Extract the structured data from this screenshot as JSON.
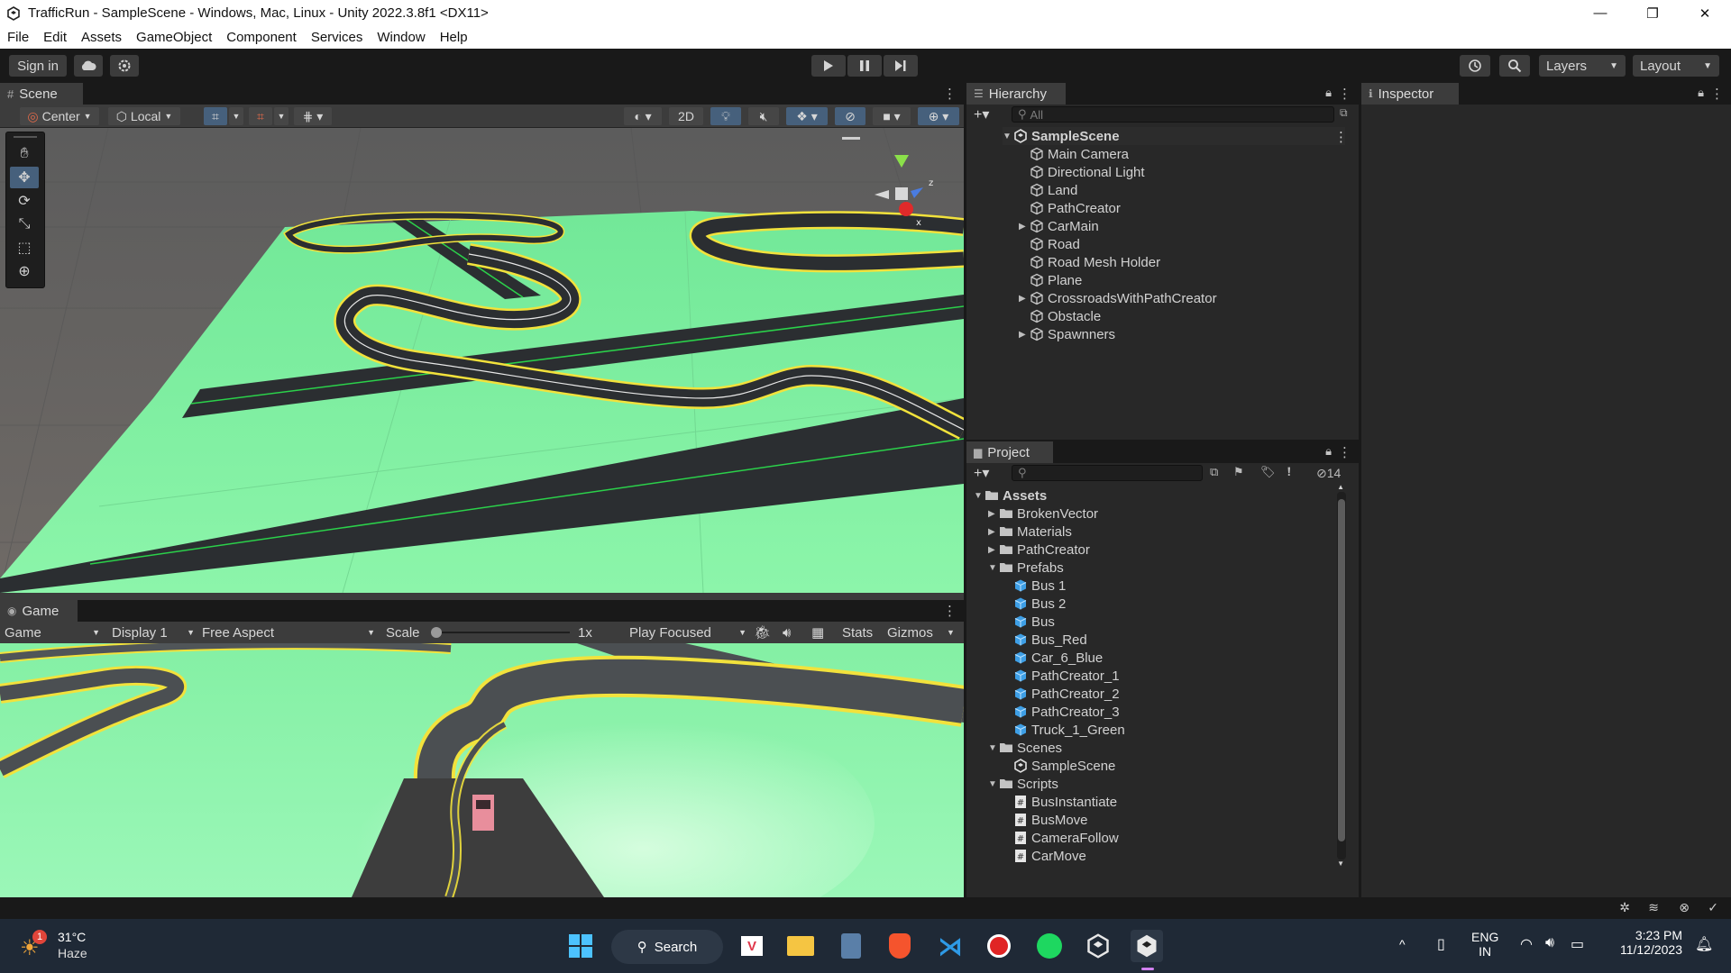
{
  "window": {
    "title": "TrafficRun - SampleScene - Windows, Mac, Linux - Unity 2022.3.8f1 <DX11>",
    "minimize": "—",
    "maximize": "❐",
    "close": "✕"
  },
  "menu": [
    "File",
    "Edit",
    "Assets",
    "GameObject",
    "Component",
    "Services",
    "Window",
    "Help"
  ],
  "toolbar": {
    "sign_in": "Sign in",
    "layers": "Layers",
    "layout": "Layout"
  },
  "scene": {
    "tab": "Scene",
    "pivot": "Center",
    "space": "Local",
    "mode_2d": "2D"
  },
  "game": {
    "tab": "Game",
    "view": "Game",
    "display": "Display 1",
    "aspect": "Free Aspect",
    "scale_label": "Scale",
    "scale_value": "1x",
    "play_mode": "Play Focused",
    "stats": "Stats",
    "gizmos": "Gizmos"
  },
  "hierarchy": {
    "tab": "Hierarchy",
    "search_placeholder": "All",
    "scene": "SampleScene",
    "items": [
      {
        "label": "Main Camera",
        "expandable": false
      },
      {
        "label": "Directional Light",
        "expandable": false
      },
      {
        "label": "Land",
        "expandable": false
      },
      {
        "label": "PathCreator",
        "expandable": false
      },
      {
        "label": "CarMain",
        "expandable": true
      },
      {
        "label": "Road",
        "expandable": false
      },
      {
        "label": "Road Mesh Holder",
        "expandable": false
      },
      {
        "label": "Plane",
        "expandable": false
      },
      {
        "label": "CrossroadsWithPathCreator",
        "expandable": true
      },
      {
        "label": "Obstacle",
        "expandable": false
      },
      {
        "label": "Spawnners",
        "expandable": true
      }
    ]
  },
  "project": {
    "tab": "Project",
    "hidden_count": "14",
    "tree": [
      {
        "label": "Assets",
        "type": "folder-open",
        "depth": 0,
        "arrow": "down",
        "bold": true
      },
      {
        "label": "BrokenVector",
        "type": "folder",
        "depth": 1,
        "arrow": "right"
      },
      {
        "label": "Materials",
        "type": "folder",
        "depth": 1,
        "arrow": "right"
      },
      {
        "label": "PathCreator",
        "type": "folder",
        "depth": 1,
        "arrow": "right"
      },
      {
        "label": "Prefabs",
        "type": "folder-open",
        "depth": 1,
        "arrow": "down"
      },
      {
        "label": "Bus 1",
        "type": "prefab",
        "depth": 2
      },
      {
        "label": "Bus 2",
        "type": "prefab",
        "depth": 2
      },
      {
        "label": "Bus",
        "type": "prefab",
        "depth": 2
      },
      {
        "label": "Bus_Red",
        "type": "prefab",
        "depth": 2
      },
      {
        "label": "Car_6_Blue",
        "type": "prefab",
        "depth": 2
      },
      {
        "label": "PathCreator_1",
        "type": "prefab",
        "depth": 2
      },
      {
        "label": "PathCreator_2",
        "type": "prefab",
        "depth": 2
      },
      {
        "label": "PathCreator_3",
        "type": "prefab",
        "depth": 2
      },
      {
        "label": "Truck_1_Green",
        "type": "prefab",
        "depth": 2
      },
      {
        "label": "Scenes",
        "type": "folder-open",
        "depth": 1,
        "arrow": "down"
      },
      {
        "label": "SampleScene",
        "type": "scene",
        "depth": 2
      },
      {
        "label": "Scripts",
        "type": "folder-open",
        "depth": 1,
        "arrow": "down"
      },
      {
        "label": "BusInstantiate",
        "type": "script",
        "depth": 2
      },
      {
        "label": "BusMove",
        "type": "script",
        "depth": 2
      },
      {
        "label": "CameraFollow",
        "type": "script",
        "depth": 2
      },
      {
        "label": "CarMove",
        "type": "script",
        "depth": 2
      }
    ]
  },
  "inspector": {
    "tab": "Inspector"
  },
  "taskbar": {
    "weather_temp": "31°C",
    "weather_desc": "Haze",
    "weather_badge": "1",
    "search": "Search",
    "lang_top": "ENG",
    "lang_bottom": "IN",
    "time": "3:23 PM",
    "date": "11/12/2023"
  },
  "colors": {
    "ground": "#84f0a4",
    "road": "#2b2e31",
    "road_edge": "#f2e23c",
    "accent_blue": "#46607c"
  }
}
